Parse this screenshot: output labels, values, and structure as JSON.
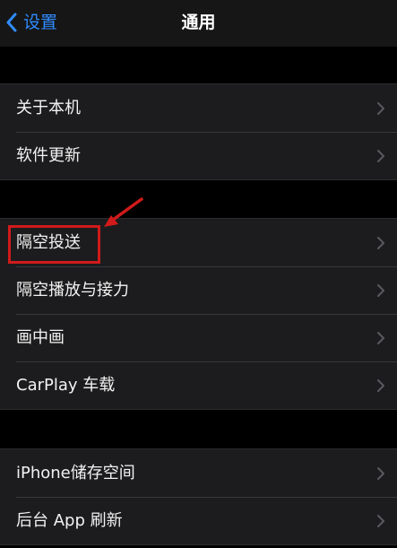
{
  "nav": {
    "back_label": "设置",
    "title": "通用"
  },
  "groups": [
    {
      "items": [
        {
          "label": "关于本机"
        },
        {
          "label": "软件更新"
        }
      ]
    },
    {
      "items": [
        {
          "label": "隔空投送"
        },
        {
          "label": "隔空播放与接力"
        },
        {
          "label": "画中画"
        },
        {
          "label": "CarPlay 车载"
        }
      ]
    },
    {
      "items": [
        {
          "label": "iPhone储存空间"
        },
        {
          "label": "后台 App 刷新"
        }
      ]
    }
  ],
  "annotation": {
    "highlight_color": "#d11a1a",
    "highlighted_item": "隔空投送"
  },
  "colors": {
    "accent": "#2f8cff",
    "background": "#000000",
    "cell": "#1c1c1e"
  }
}
